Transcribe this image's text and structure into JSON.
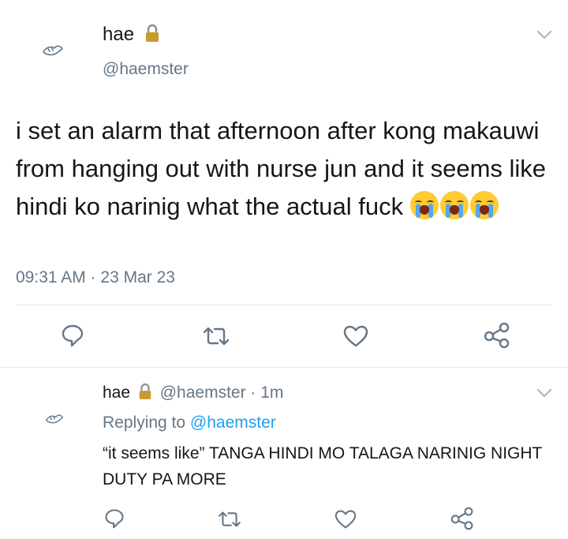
{
  "tweet": {
    "name": "hae",
    "handle": "@haemster",
    "text": "i set an alarm that afternoon after kong makauwi from hanging out with nurse jun and it seems like hindi ko narinig what the actual fuck",
    "emojis": [
      "loudly-crying-face",
      "loudly-crying-face",
      "loudly-crying-face"
    ],
    "timestamp": "09:31 AM · 23 Mar 23"
  },
  "reply": {
    "name": "hae",
    "meta": "@haemster · 1m",
    "replying_prefix": "Replying to",
    "replying_handle": "@haemster",
    "text": "“it seems like” TANGA HINDI MO TALAGA NARINIG NIGHT DUTY PA MORE"
  },
  "icons": [
    "reply-icon",
    "retweet-icon",
    "like-icon",
    "share-icon",
    "lock-icon",
    "chevron-down-icon"
  ],
  "colors": {
    "link": "#1da1f2",
    "secondary": "#657786",
    "divider": "#e1e8ed",
    "lock": "#c99a2e"
  }
}
